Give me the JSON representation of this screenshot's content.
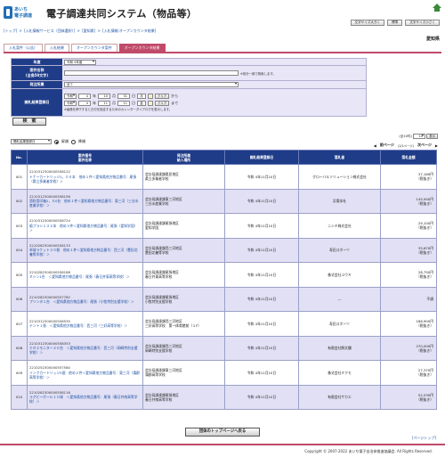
{
  "header": {
    "logo_line1": "あいち",
    "logo_line2": "電子調達",
    "title": "電子調達共同システム（物品等）",
    "buttons": [
      "文字サイズ大きく",
      "標準",
      "文字サイズ小さく"
    ]
  },
  "breadcrumb": [
    "[トップ]",
    ">",
    "[入札情報サービス（団体選択）]",
    ">",
    "[愛知県]",
    ">",
    "[入札情報:オープンカウンタ結果]"
  ],
  "prefecture": "愛知県",
  "tabs": [
    "入札案件（公告）",
    "入札結果",
    "オープンカウンタ案件",
    "オープンカウンタ結果"
  ],
  "form": {
    "year_label": "年度",
    "year_value": "令和 4年度",
    "name_label": "案件名称\n(全角50文字)",
    "name_hint": "※前分一致で検索します。",
    "dept_label": "発注所属",
    "dept_value": "全て",
    "date_label": "開札結果登録日",
    "from": {
      "era": "令和",
      "y": "4",
      "m": "10",
      "d": "31",
      "w": "月",
      "word": "から"
    },
    "to": {
      "era": "令和",
      "y": "4",
      "m": "11",
      "d": "11",
      "w": "金",
      "word": "まで"
    },
    "cal_clear": "クリア",
    "date_note": "※画像を押下すると日付を指定するためのカレンダーダイアログを表示します。",
    "search_button": "検　索"
  },
  "sort": {
    "select_value": "開札結果登録日",
    "asc_label": "昇順",
    "desc_label": "降順"
  },
  "pager": {
    "count": "(全10件)",
    "per_page": "10",
    "per_page_btn": "表示",
    "page_info": "(1/1ページ)",
    "prev": "前ページ",
    "next": "次ページ"
  },
  "table": {
    "headers": [
      "No.",
      "案件番号\n案件名称",
      "発注所属\n納入場所",
      "開札結果登録日",
      "落札者",
      "落札金額"
    ],
    "rows": [
      {
        "no": "001",
        "id": "2210312300000558122",
        "name": "トナーカートリッジ1，００本　他め１件＜愛知県他方物品番号：尾張（県立多業者学校）＞",
        "dept": "会計局調達課県民地区\n県立多業者学校",
        "date": "令和 4年11月10日",
        "winner": "グローバルソリューション株式会社",
        "amount": "37,169円",
        "tax": "（税抜き）"
      },
      {
        "no": "002",
        "id": "2210312300000558156",
        "name": "酒吹用印箱2，０0台　他め１件＜愛知県他方物品番号：東三河（三谷水産業学校）＞",
        "dept": "会計局調達課東三河地区\n三谷水産業学校",
        "date": "令和 4年11月10日",
        "winner": "浜電本社",
        "amount": "145,940円",
        "tax": "（税抜き）"
      },
      {
        "no": "003",
        "id": "2210312300000558724",
        "name": "歯ブラシ１３２本　他め３件＜愛知県他方物品番号：尾張（愛知学園）＞",
        "dept": "会計局調達課尾張地区\n愛知学園",
        "date": "令和 4年11月10日",
        "winner": "ニシキ株式会社",
        "amount": "29,100円",
        "tax": "（税抜き）"
      },
      {
        "no": "004",
        "id": "2210282300000558133",
        "name": "卓球ラケット３０極　他め１件＜愛知県他方物品番号：西三河（豊田北養等学校）＞",
        "dept": "会計局調達課西三河地区\n豊田北養等学校",
        "date": "令和 4年11月10日",
        "winner": "寿田スポーツ",
        "amount": "35,670円",
        "tax": "（税抜き）"
      },
      {
        "no": "005",
        "id": "2210282300000558188",
        "name": "ミシン1台　＜愛知県他方物品番号：尾張（春日井東高等学校）＞",
        "dept": "会計局調達課尾張地区\n春日井東高等学校",
        "date": "令和 4年11月10日",
        "winner": "株式会社ユウキ",
        "amount": "28,750円",
        "tax": "（税抜き）"
      },
      {
        "no": "006",
        "id": "2210282300000557782",
        "name": "プリンタ１台　＜愛知県他方物品番号：尾張（小牧特別支援学校）＞",
        "dept": "会計局調達課尾張地区\n小牧特別支援学校",
        "date": "令和 4年11月10日",
        "winner": "---",
        "amount": "不調",
        "tax": ""
      },
      {
        "no": "007",
        "id": "2210312300000558535",
        "name": "テント１張　＜愛知県他方物品番号：西三河（三好高等学校）＞",
        "dept": "会計局調達課西三河地区\n三好高等学校　第一体育館前（１F）",
        "date": "令和 4年11月10日",
        "winner": "寿田スポーツ",
        "amount": "186,900円",
        "tax": "（税抜き）"
      },
      {
        "no": "008",
        "id": "2210312300000558353",
        "name": "ＣＯ２モニター２０台　＜愛知県他方物品番号：西三河（岡崎特別支援学校）＞",
        "dept": "会計局調達課西三河地区\n岡崎特別支援学校",
        "date": "令和 4年11月10日",
        "winner": "有限会社鮮文舗",
        "amount": "270,000円",
        "tax": "（税抜き）"
      },
      {
        "no": "009",
        "id": "2210252300000557580",
        "name": "インクカートリッジ5個　他め２件＜愛知県他方物品番号：東三河（蒲郡高等学校）＞",
        "dept": "会計局調達課東三河地区\n蒲郡高等学校",
        "date": "令和 4年11月10日",
        "winner": "株式会社ミクモ",
        "amount": "27,370円",
        "tax": "（税抜き）"
      },
      {
        "no": "010",
        "id": "2210282300000558116",
        "name": "ラグビーボール１０球　＜愛知県他方物品番号：尾張（春日井南高等学校）＞",
        "dept": "会計局調達課尾張地区\n春日井南高等学校",
        "date": "令和 4年11月10日",
        "winner": "有限会社サカエ",
        "amount": "52,530円",
        "tax": "（税抜き）"
      }
    ]
  },
  "back_button": "団体のトップページへ戻る",
  "page_top": "[ページトップ]",
  "footer": "Copyright © 2007-2022 あいち電子自治体推進協議会. All Rights Reserved.",
  "colors": {
    "header_blue": "#1f3c88",
    "accent_pink": "#c04a6a",
    "row_alt": "#e2e0f4",
    "link": "#1a4fa3"
  },
  "icons": [
    "home-icon",
    "calendar-icon",
    "radio-icon",
    "chevron-left-icon",
    "chevron-right-icon"
  ]
}
